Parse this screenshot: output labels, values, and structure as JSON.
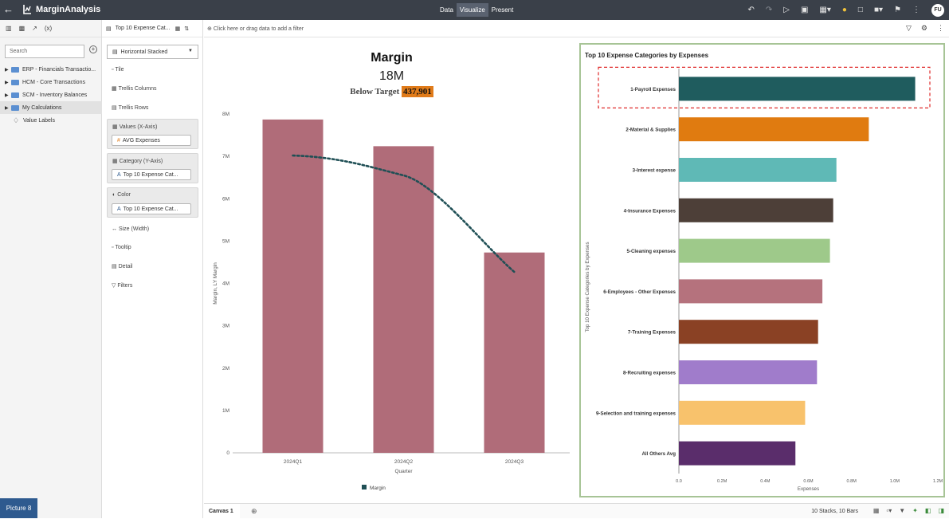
{
  "app": {
    "title": "MarginAnalysis",
    "modes": [
      "Data",
      "Visualize",
      "Present"
    ],
    "active_mode": "Visualize",
    "user_initials": "FU"
  },
  "left_panel": {
    "search_placeholder": "Search",
    "tree": [
      {
        "label": "ERP - Financials Transactio...",
        "type": "folder"
      },
      {
        "label": "HCM - Core Transactions",
        "type": "folder"
      },
      {
        "label": "SCM - Inventory Balances",
        "type": "folder"
      },
      {
        "label": "My Calculations",
        "type": "folder",
        "selected": true
      },
      {
        "label": "Value Labels",
        "type": "tag"
      }
    ],
    "picture_tab": "Picture 8"
  },
  "grammar": {
    "viz_title": "Top 10 Expense Cat...",
    "viz_type": "Horizontal Stacked",
    "items": {
      "tile": "Tile",
      "trellis_columns": "Trellis Columns",
      "trellis_rows": "Trellis Rows",
      "size": "Size (Width)",
      "tooltip": "Tooltip",
      "detail": "Detail",
      "filters": "Filters"
    },
    "values": {
      "label": "Values (X-Axis)",
      "pill": "AVG Expenses"
    },
    "category": {
      "label": "Category (Y-Axis)",
      "pill": "Top 10 Expense Cat..."
    },
    "color": {
      "label": "Color",
      "pill": "Top 10 Expense Cat..."
    }
  },
  "filterbar": {
    "text": "Click here or drag data to add a filter"
  },
  "tile": {
    "title": "Margin",
    "value": "18M",
    "subtitle": "Below Target",
    "delta": "437,901",
    "delta_color": "#e07b1a"
  },
  "chart_data": [
    {
      "type": "bar",
      "categories": [
        "2024Q1",
        "2024Q2",
        "2024Q3"
      ],
      "series": [
        {
          "name": "Margin",
          "values": [
            7870000,
            7240000,
            4730000
          ],
          "color": "#b06c79"
        }
      ],
      "trendline": [
        7020000,
        6550000,
        4270000
      ],
      "trendline_color": "#1f4f55",
      "xlabel": "Quarter",
      "ylabel": "Margin, LY Margin",
      "ylim": [
        0,
        8000000
      ],
      "yticks": [
        "0",
        "1M",
        "2M",
        "3M",
        "4M",
        "5M",
        "6M",
        "7M",
        "8M"
      ],
      "yticks_values": [
        0,
        1000000,
        2000000,
        3000000,
        4000000,
        5000000,
        6000000,
        7000000,
        8000000
      ],
      "legend": "bottom"
    },
    {
      "type": "bar",
      "orientation": "horizontal",
      "title": "Top 10 Expense Categories by Expenses",
      "categories": [
        "1-Payroll Expenses",
        "2-Material & Supplies",
        "3-Interest expense",
        "4-Insurance Expenses",
        "5-Cleaning expenses",
        "6-Employees - Other Expenses",
        "7-Training Expenses",
        "8-Recruiting expenses",
        "9-Selection and training expenses",
        "All Others Avg"
      ],
      "values": [
        1095000,
        880000,
        730000,
        715000,
        700000,
        665000,
        645000,
        640000,
        585000,
        540000
      ],
      "colors": [
        "#1f5c5e",
        "#e07b10",
        "#5fb9b6",
        "#4d3f38",
        "#9ec98a",
        "#b5727d",
        "#8a4124",
        "#a07ccb",
        "#f8c26c",
        "#5a2d6b"
      ],
      "xlabel": "Expenses",
      "ylabel": "Top 10 Expense Categories by Expenses",
      "xlim": [
        0,
        1200000
      ],
      "xticks": [
        "0.0",
        "0.2M",
        "0.4M",
        "0.6M",
        "0.8M",
        "1.0M",
        "1.2M"
      ],
      "xticks_values": [
        0,
        200000,
        400000,
        600000,
        800000,
        1000000,
        1200000
      ],
      "highlighted": "1-Payroll Expenses",
      "highlight_color": "#e02b2b"
    }
  ],
  "bottombar": {
    "canvas_tab": "Canvas 1",
    "stats": "10 Stacks, 10 Bars"
  }
}
